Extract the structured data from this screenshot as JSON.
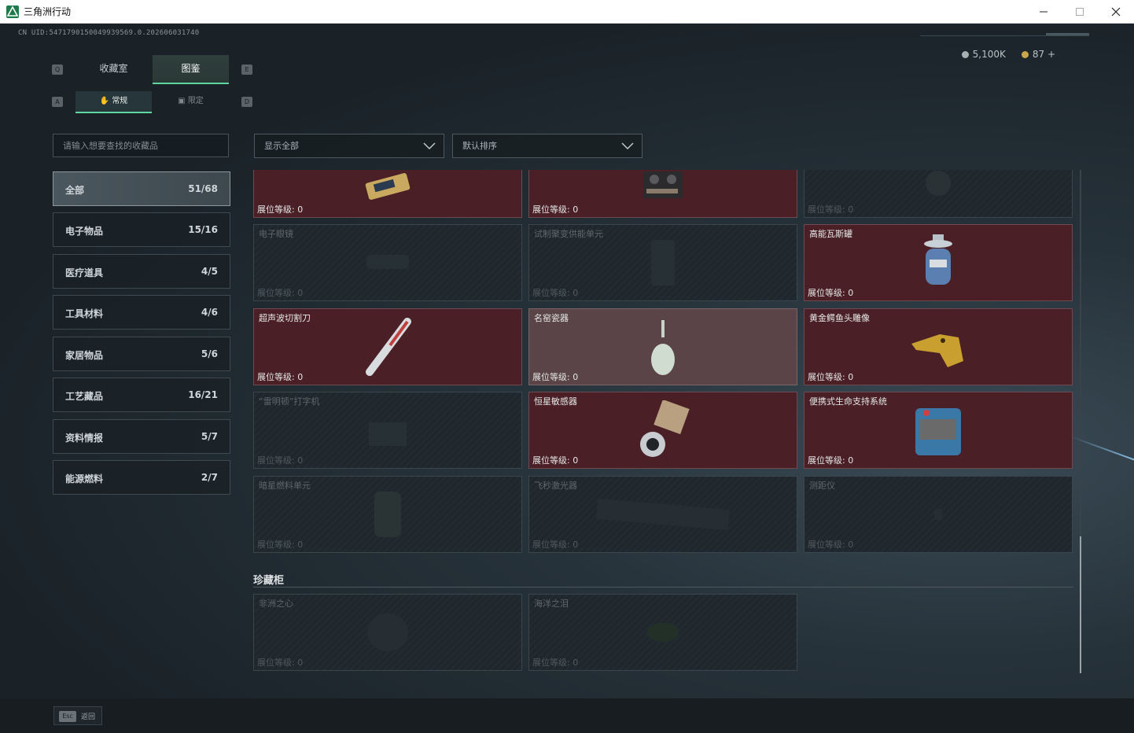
{
  "window": {
    "title": "三角洲行动",
    "minimize": "—",
    "maximize": "☐",
    "close": "✕"
  },
  "header": {
    "uid": "CN UID:5471790150049939569.0.202606031740",
    "currency": [
      {
        "value": "5,100K",
        "color": "#a8b0b4"
      },
      {
        "value": "87 +",
        "color": "#c8a64a"
      }
    ]
  },
  "tabs": {
    "key_left": "Q",
    "key_right": "E",
    "items": [
      {
        "label": "收藏室"
      },
      {
        "label": "图鉴"
      }
    ],
    "active_index": 1
  },
  "subtabs": {
    "key_left": "A",
    "key_right": "D",
    "items": [
      {
        "label": "常规"
      },
      {
        "label": "限定"
      }
    ],
    "active_index": 0
  },
  "search": {
    "placeholder": "请输入想要查找的收藏品"
  },
  "filters": {
    "show": {
      "value": "显示全部"
    },
    "sort": {
      "value": "默认排序"
    }
  },
  "categories": [
    {
      "name": "全部",
      "count": "51/68"
    },
    {
      "name": "电子物品",
      "count": "15/16"
    },
    {
      "name": "医疗道具",
      "count": "4/5"
    },
    {
      "name": "工具材料",
      "count": "4/6"
    },
    {
      "name": "家居物品",
      "count": "5/6"
    },
    {
      "name": "工艺藏品",
      "count": "16/21"
    },
    {
      "name": "资料情报",
      "count": "5/7"
    },
    {
      "name": "能源燃料",
      "count": "2/7"
    }
  ],
  "level_label": "展位等级:",
  "items": [
    {
      "name": "",
      "level": "0",
      "owned": true,
      "icon": "electronic-module-icon"
    },
    {
      "name": "",
      "level": "0",
      "owned": true,
      "icon": "tape-recorder-icon"
    },
    {
      "name": "",
      "level": "0",
      "owned": false,
      "icon": "mystery-item-icon"
    },
    {
      "name": "电子眼镜",
      "level": "0",
      "owned": false,
      "icon": "glasses-icon"
    },
    {
      "name": "试制聚变供能单元",
      "level": "0",
      "owned": false,
      "icon": "fusion-cell-icon"
    },
    {
      "name": "高能瓦斯罐",
      "level": "0",
      "owned": true,
      "icon": "gas-tank-icon"
    },
    {
      "name": "超声波切割刀",
      "level": "0",
      "owned": true,
      "icon": "ultrasonic-knife-icon"
    },
    {
      "name": "名窑瓷器",
      "level": "0",
      "owned": true,
      "icon": "porcelain-vase-icon"
    },
    {
      "name": "黄金鳄鱼头雕像",
      "level": "0",
      "owned": true,
      "icon": "gold-crocodile-icon"
    },
    {
      "name": "“雷明顿”打字机",
      "level": "0",
      "owned": false,
      "icon": "typewriter-icon"
    },
    {
      "name": "恒星敏感器",
      "level": "0",
      "owned": true,
      "icon": "star-sensor-icon"
    },
    {
      "name": "便携式生命支持系统",
      "level": "0",
      "owned": true,
      "icon": "life-support-icon"
    },
    {
      "name": "暗星燃料单元",
      "level": "0",
      "owned": false,
      "icon": "fuel-cell-icon"
    },
    {
      "name": "飞秒激光器",
      "level": "0",
      "owned": false,
      "icon": "laser-icon"
    },
    {
      "name": "测距仪",
      "level": "0",
      "owned": false,
      "icon": "rangefinder-icon"
    }
  ],
  "treasure": {
    "title": "珍藏柜",
    "items": [
      {
        "name": "非洲之心",
        "level": "0",
        "owned": false,
        "icon": "diamond-icon"
      },
      {
        "name": "海洋之泪",
        "level": "0",
        "owned": false,
        "icon": "gem-icon"
      }
    ]
  },
  "footer": {
    "esc_key": "Esc",
    "esc_label": "返回"
  }
}
